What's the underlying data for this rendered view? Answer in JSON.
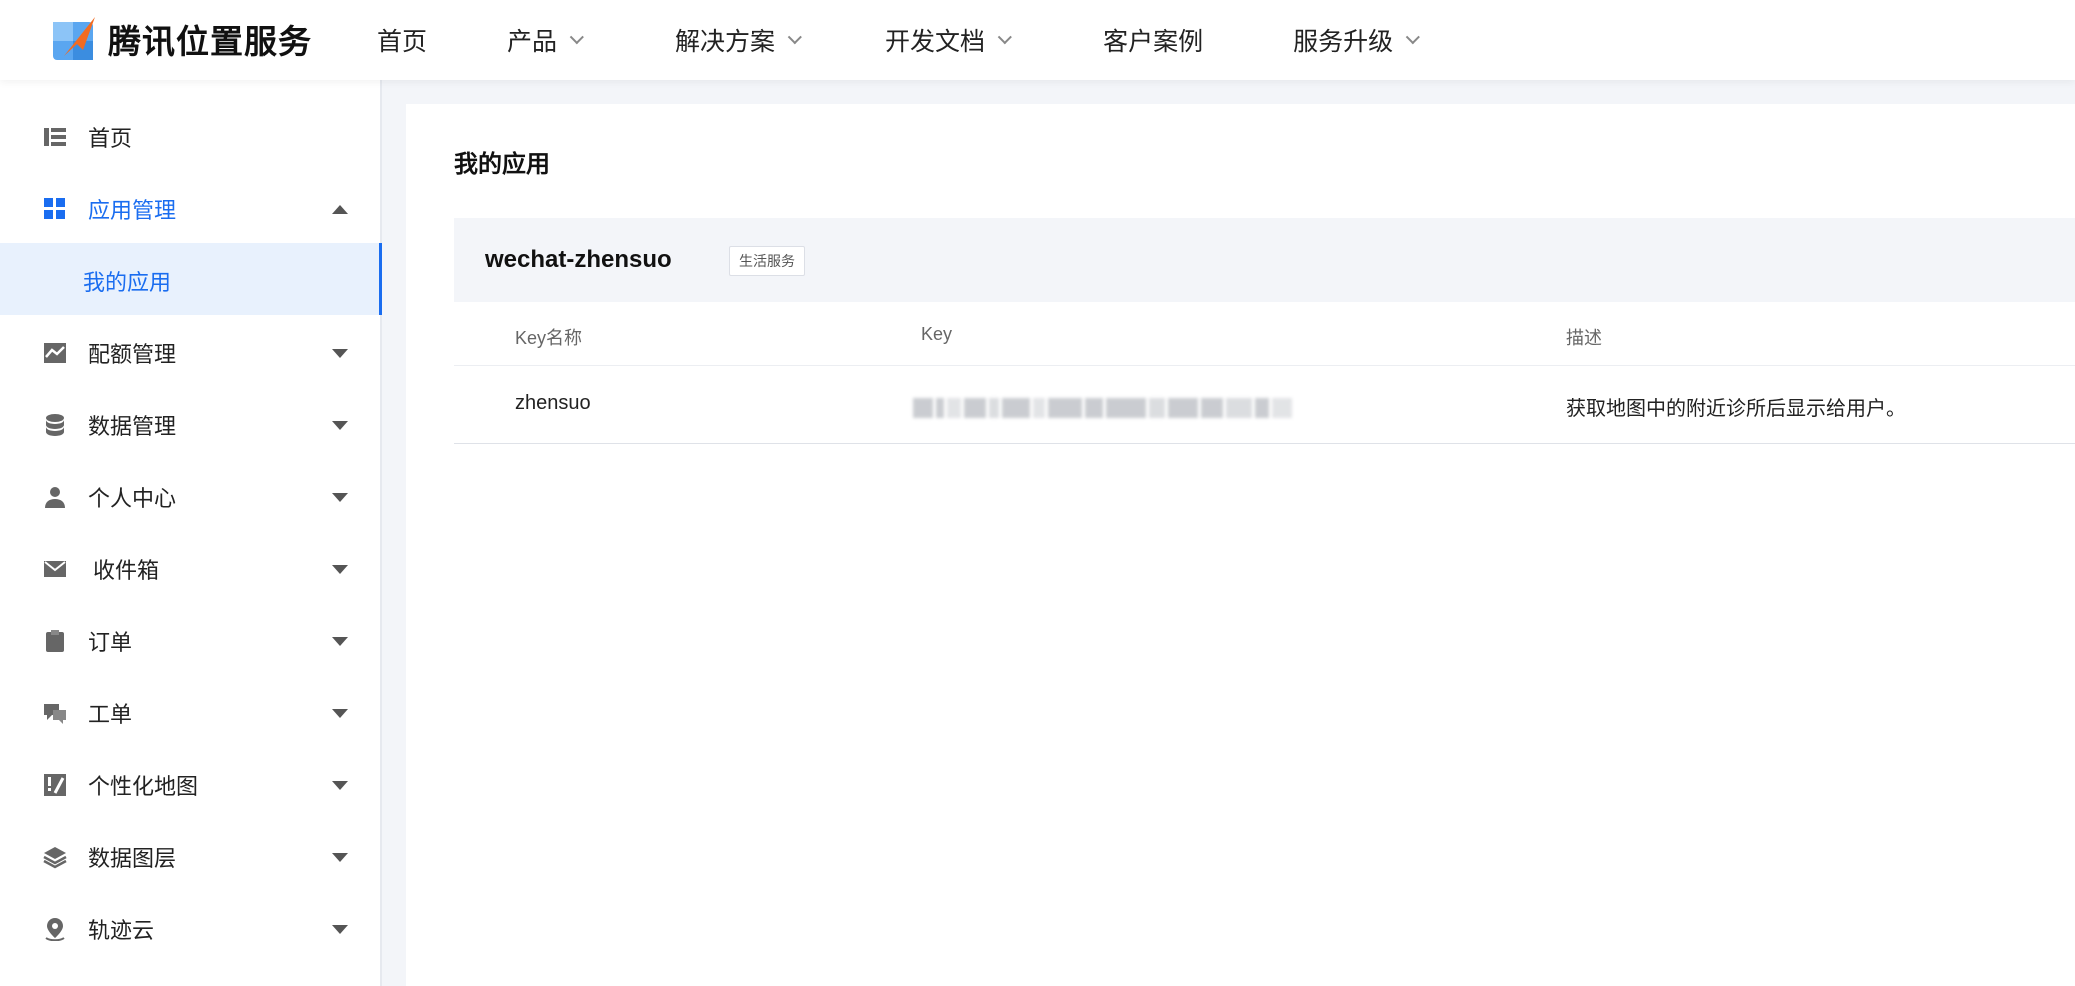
{
  "brand": {
    "name": "腾讯位置服务"
  },
  "nav": [
    {
      "label": "首页",
      "has_dropdown": false
    },
    {
      "label": "产品",
      "has_dropdown": true
    },
    {
      "label": "解决方案",
      "has_dropdown": true
    },
    {
      "label": "开发文档",
      "has_dropdown": true
    },
    {
      "label": "客户案例",
      "has_dropdown": false
    },
    {
      "label": "服务升级",
      "has_dropdown": true
    }
  ],
  "sidebar": {
    "items": [
      {
        "label": "首页",
        "icon": "list-icon"
      },
      {
        "label": "应用管理",
        "icon": "grid-icon",
        "active": true,
        "expanded": true
      },
      {
        "label": "配额管理",
        "icon": "chart-icon"
      },
      {
        "label": "数据管理",
        "icon": "database-icon"
      },
      {
        "label": "个人中心",
        "icon": "user-icon"
      },
      {
        "label": "收件箱",
        "icon": "mail-icon"
      },
      {
        "label": "订单",
        "icon": "clipboard-icon"
      },
      {
        "label": "工单",
        "icon": "chat-icon"
      },
      {
        "label": "个性化地图",
        "icon": "custom-map-icon"
      },
      {
        "label": "数据图层",
        "icon": "layers-icon"
      },
      {
        "label": "轨迹云",
        "icon": "location-pin-icon"
      }
    ],
    "sub_item": "我的应用"
  },
  "main": {
    "title": "我的应用",
    "app": {
      "name": "wechat-zhensuo",
      "tag": "生活服务"
    },
    "table": {
      "headers": [
        "Key名称",
        "Key",
        "描述"
      ],
      "rows": [
        {
          "key_name": "zhensuo",
          "key_value": "(blurred)",
          "description": "获取地图中的附近诊所后显示给用户。"
        }
      ]
    }
  },
  "colors": {
    "accent": "#1a6df0",
    "active_bg": "#e8f1fd",
    "page_bg": "#f3f5f9"
  }
}
